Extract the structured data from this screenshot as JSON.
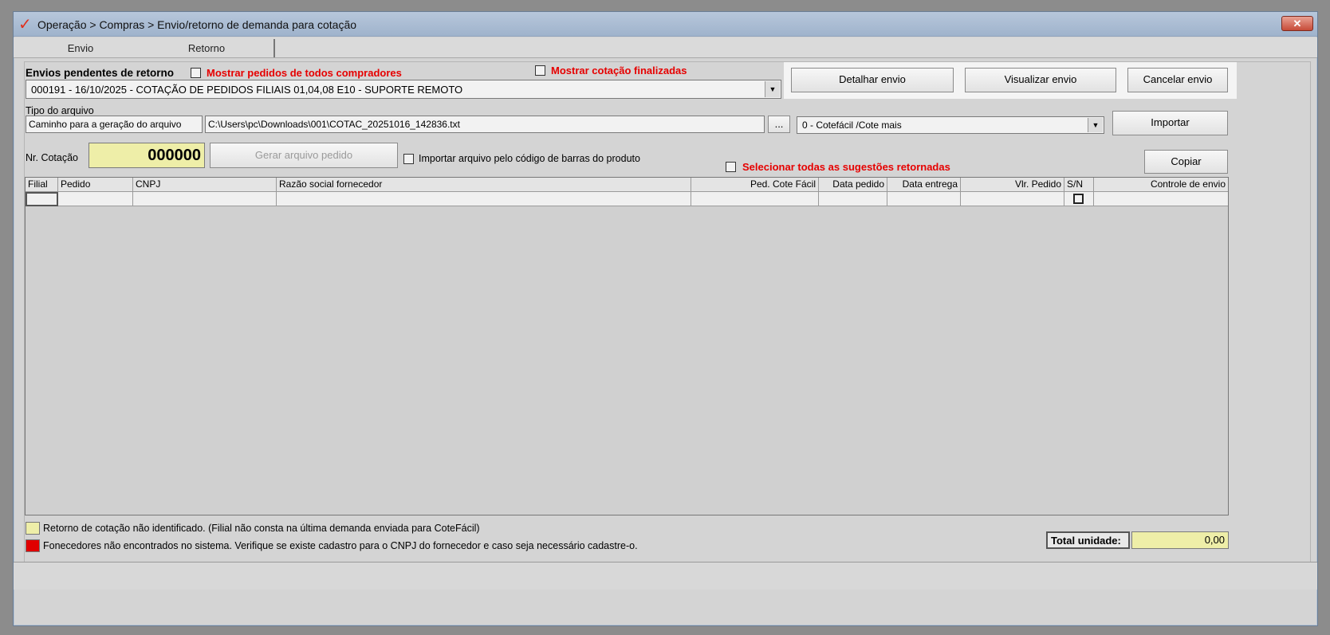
{
  "window": {
    "title": "Operação > Compras > Envio/retorno de demanda para cotação",
    "close_label": "✕"
  },
  "tabs": [
    {
      "label": "Envio"
    },
    {
      "label": "Retorno"
    }
  ],
  "envios": {
    "label": "Envios pendentes de retorno",
    "show_all_buyers_label": "Mostrar pedidos de todos compradores",
    "show_finished_label": "Mostrar cotação finalizadas",
    "selected": "000191 - 16/10/2025 - COTAÇÃO DE PEDIDOS FILIAIS 01,04,08 E10 - SUPORTE REMOTO"
  },
  "actions": {
    "detalhar": "Detalhar envio",
    "visualizar": "Visualizar envio",
    "cancelar": "Cancelar envio"
  },
  "arquivo": {
    "path_label": "Caminho para a geração do arquivo",
    "path_value": "C:\\Users\\pc\\Downloads\\001\\COTAC_20251016_142836.txt",
    "browse_label": "...",
    "tipo_label": "Tipo do arquivo",
    "tipo_value": "0 - Cotefácil /Cote mais",
    "importar_label": "Importar"
  },
  "cotacao": {
    "label": "Nr. Cotação",
    "value": "000000",
    "gerar_label": "Gerar arquivo pedido",
    "barcode_label": "Importar arquivo pelo código de barras do produto",
    "select_all_label": "Selecionar todas as sugestões retornadas",
    "copiar_label": "Copiar"
  },
  "grid": {
    "columns": [
      "Filial",
      "Pedido",
      "CNPJ",
      "Razão social fornecedor",
      "Ped. Cote Fácil",
      "Data pedido",
      "Data entrega",
      "Vlr. Pedido",
      "S/N",
      "Controle de envio"
    ]
  },
  "legend": [
    {
      "color": "#eeeea8",
      "text": "Retorno de cotação não identificado. (Filial não consta na última demanda enviada para CoteFácil)"
    },
    {
      "color": "#e00000",
      "text": "Fonecedores não encontrados no sistema. Verifique se existe cadastro para o CNPJ do fornecedor e caso seja necessário cadastre-o."
    }
  ],
  "total": {
    "label": "Total unidade:",
    "value": "0,00"
  }
}
